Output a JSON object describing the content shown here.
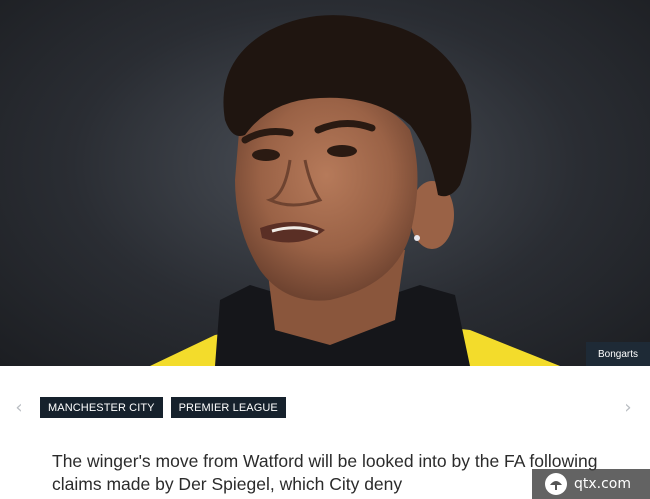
{
  "hero": {
    "photo_credit": "Bongarts"
  },
  "navigation": {
    "prev_icon": "chevron-left-icon",
    "next_icon": "chevron-right-icon",
    "prev_glyph": "‹",
    "next_glyph": "›"
  },
  "tags": [
    {
      "label": "MANCHESTER CITY"
    },
    {
      "label": "PREMIER LEAGUE"
    }
  ],
  "article": {
    "headline": "The winger's move from Watford will be looked into by the FA following claims made by Der Spiegel, which City deny"
  },
  "watermark": {
    "text": "qtx.com"
  },
  "colors": {
    "tag_background": "#16212c",
    "credit_background": "#1e2a36",
    "jersey_yellow": "#f3dc2b"
  }
}
